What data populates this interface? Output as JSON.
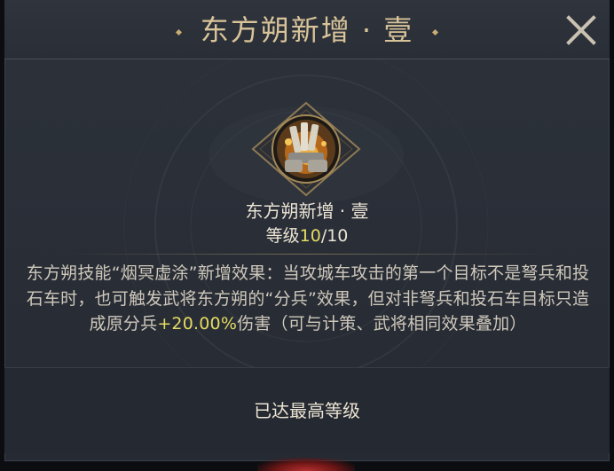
{
  "dialog": {
    "title": "东方朔新增 · 壹",
    "close_icon": "close-icon"
  },
  "skill": {
    "icon": "siege-claw-icon",
    "name": "东方朔新增 · 壹",
    "level_prefix": "等级",
    "level_current": "10",
    "level_sep_max": "/10",
    "description_part1": "东方朔技能“烟冥虚涂”新增效果：当攻城车攻击的第一个目标不是弩兵和投石车时，也可触发武将东方朔的“分兵”效果，但对非弩兵和投石车目标只造成原分兵",
    "description_highlight": "+20.00%",
    "description_part2": "伤害（可与计策、武将相同效果叠加）"
  },
  "footer": {
    "status": "已达最高等级"
  },
  "colors": {
    "title_gold": "#d9c49a",
    "highlight_yellow": "#e6dc63",
    "panel_bg": "#2a2f38",
    "text_light": "#ebe4d4"
  }
}
